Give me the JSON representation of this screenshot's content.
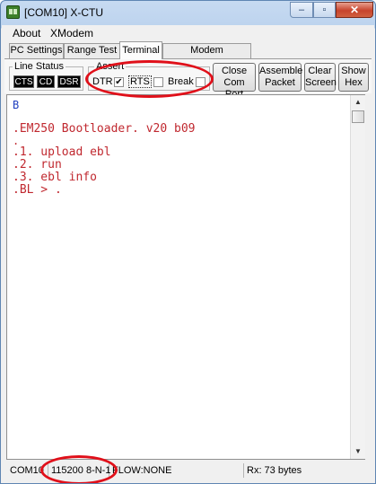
{
  "window": {
    "title": "[COM10] X-CTU",
    "minimize": "–",
    "maximize": "▫",
    "close": "✕"
  },
  "menu": {
    "items": [
      "About",
      "XModem"
    ]
  },
  "tabs": [
    {
      "label": "PC Settings"
    },
    {
      "label": "Range Test"
    },
    {
      "label": "Terminal",
      "active": true
    },
    {
      "label": "Modem Configuration"
    }
  ],
  "line_status": {
    "label": "Line Status",
    "indicators": [
      "CTS",
      "CD",
      "DSR"
    ]
  },
  "assert": {
    "label": "Assert",
    "dtr": {
      "label": "DTR",
      "checked": true,
      "mark": "✔"
    },
    "rts": {
      "label": "RTS",
      "checked": false
    },
    "brk": {
      "label": "Break",
      "checked": false
    }
  },
  "buttons": {
    "close_port": [
      "Close",
      "Com Port"
    ],
    "assemble_packet": [
      "Assemble",
      "Packet"
    ],
    "clear_screen": [
      "Clear",
      "Screen"
    ],
    "show_hex": [
      "Show",
      "Hex"
    ]
  },
  "terminal": {
    "lines": [
      {
        "text": "B",
        "color": "#1f3fbf"
      },
      {
        "text": "",
        "color": "#c0282f"
      },
      {
        "text": ".EM250 Bootloader. v20 b09",
        "color": "#c0282f"
      },
      {
        "text": ".",
        "color": "#c0282f"
      },
      {
        "text": ".1. upload ebl",
        "color": "#c0282f"
      },
      {
        "text": ".2. run",
        "color": "#c0282f"
      },
      {
        "text": ".3. ebl info",
        "color": "#c0282f"
      },
      {
        "text": ".BL > .",
        "color": "#c0282f"
      }
    ]
  },
  "scroll": {
    "up": "▲",
    "down": "▼"
  },
  "status": {
    "port": "COM10",
    "settings": "115200 8-N-1",
    "flow": "FLOW:NONE",
    "rx": "Rx: 73 bytes"
  },
  "colors": {
    "annotation": "#e0101a",
    "terminal_text": "#c0282f",
    "terminal_input": "#1f3fbf"
  }
}
